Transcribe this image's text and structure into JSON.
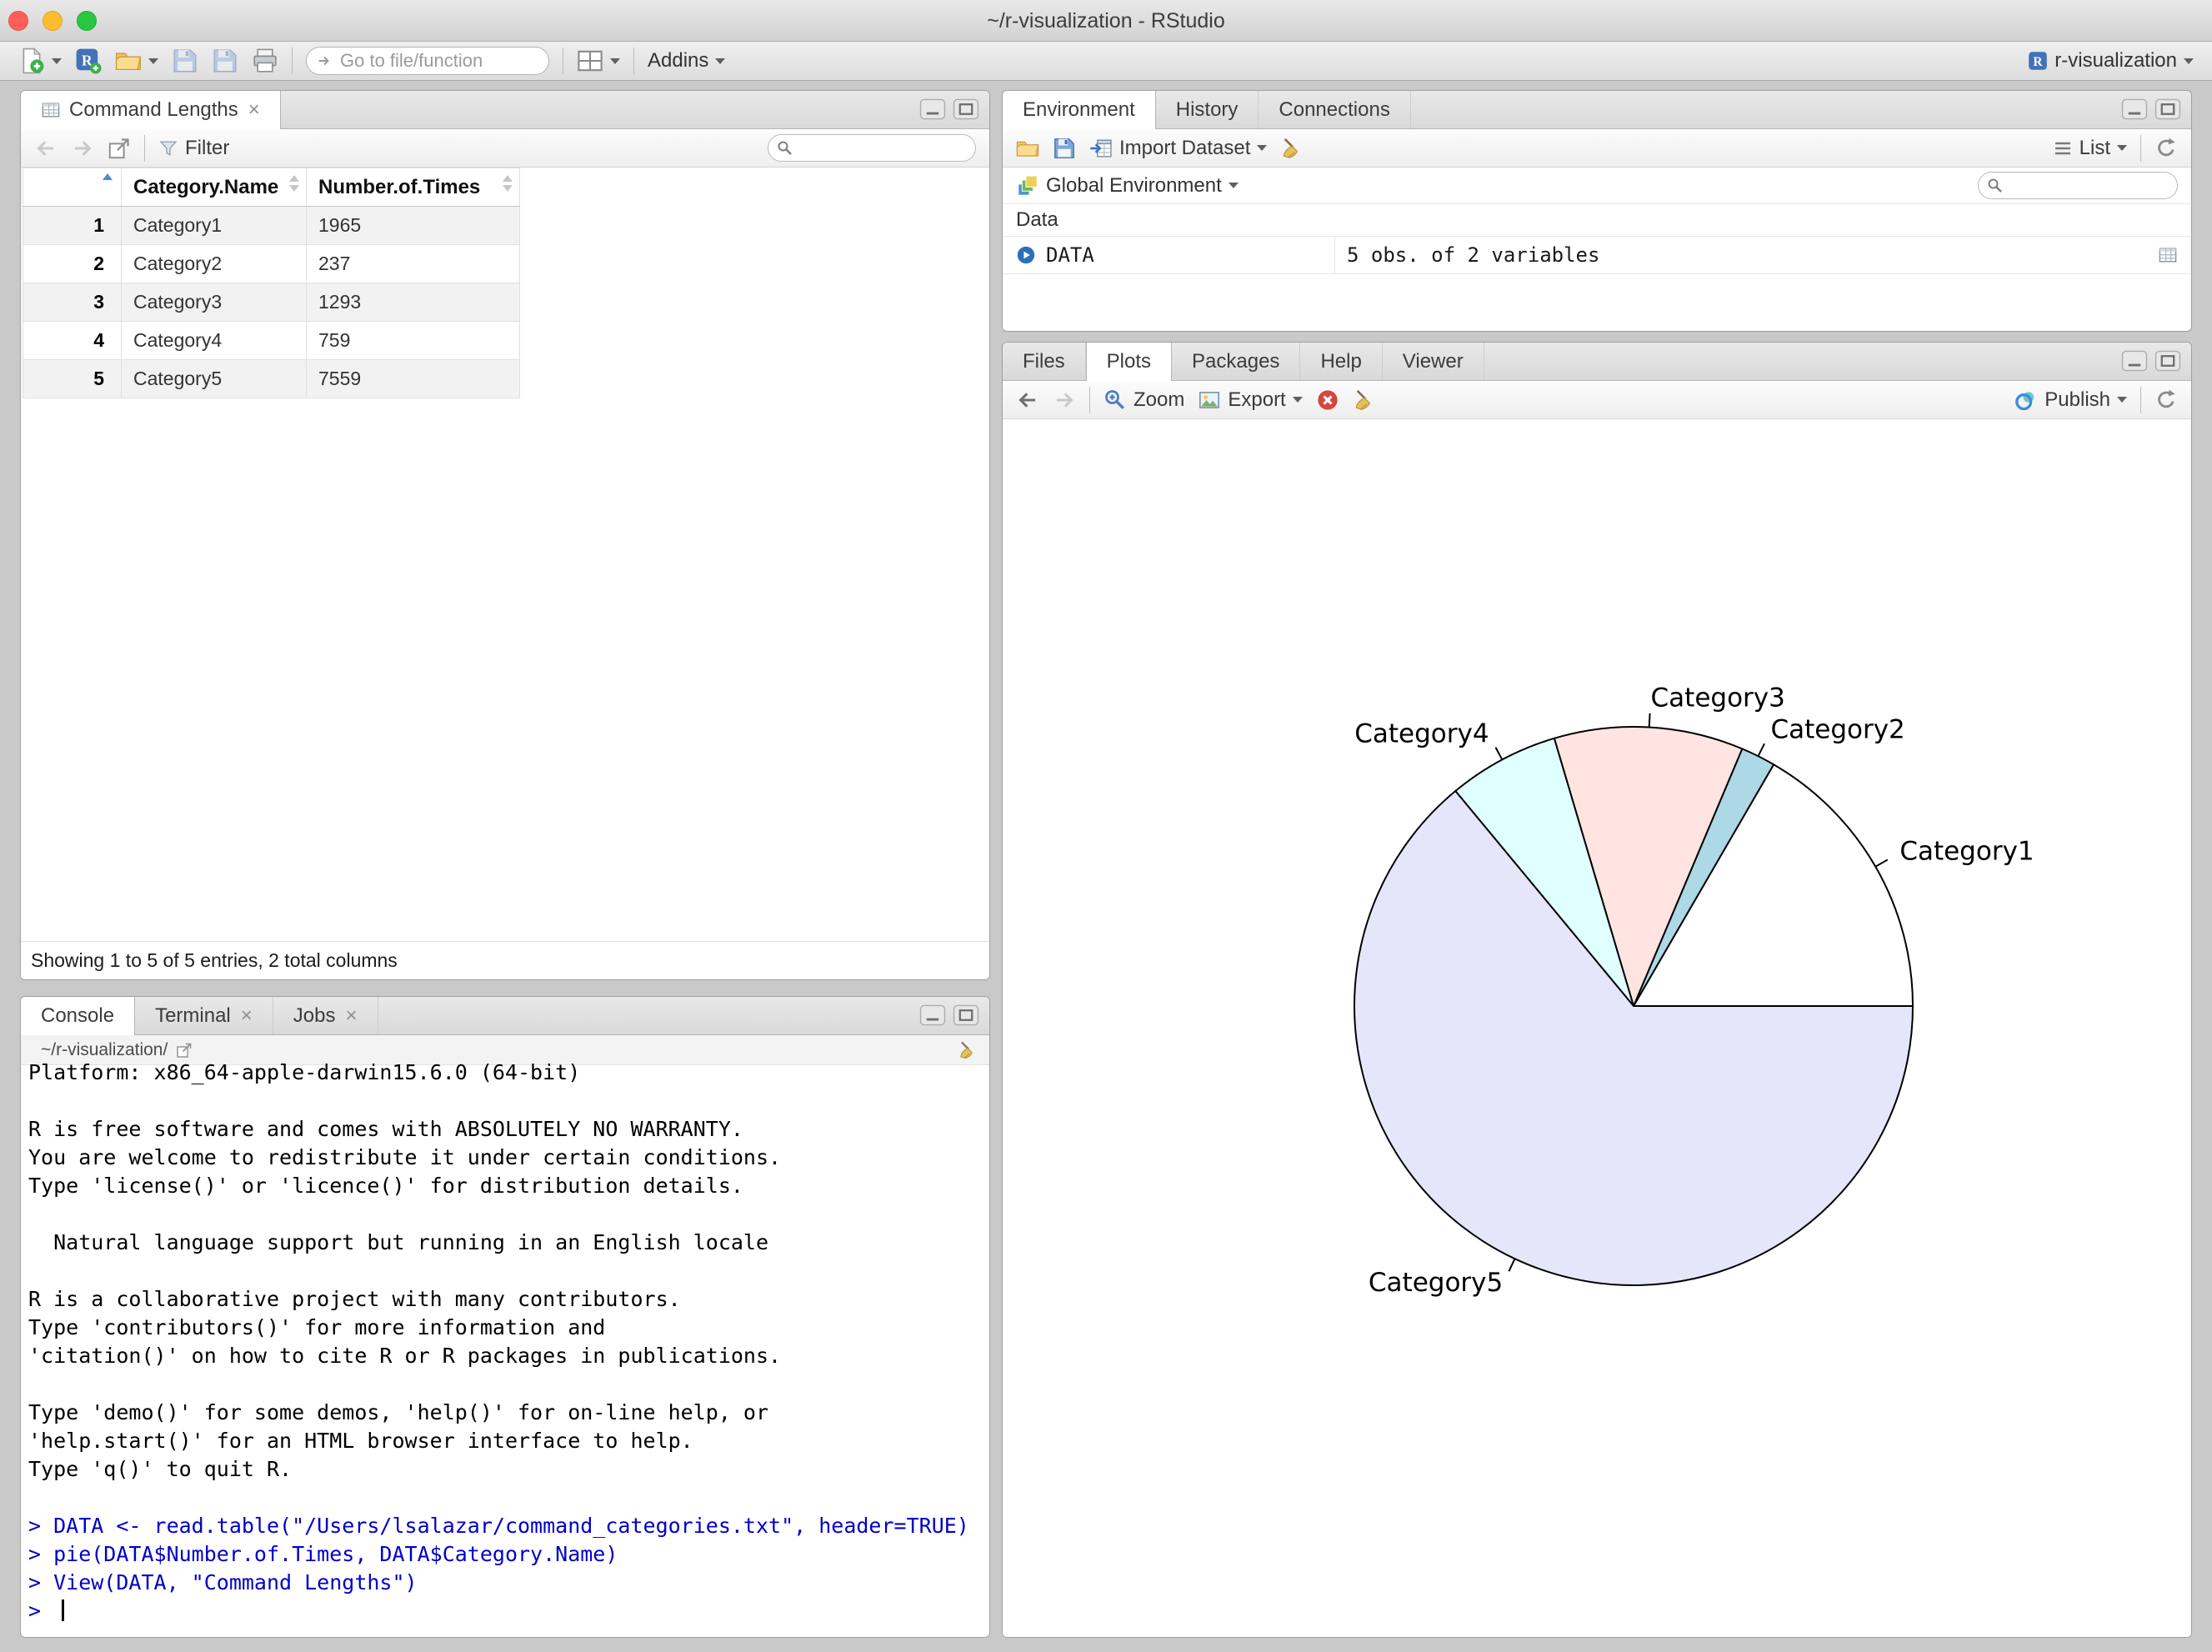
{
  "window": {
    "title": "~/r-visualization - RStudio"
  },
  "icons": {
    "close_glyph": "×",
    "r_logo": "R"
  },
  "colors": {
    "command_blue": "#0000C8",
    "traffic_lights": [
      "#FF5F57",
      "#FEBC2E",
      "#28C840"
    ]
  },
  "main_toolbar": {
    "goto_placeholder": "Go to file/function",
    "addins_label": "Addins",
    "project_name": "r-visualization"
  },
  "data_viewer": {
    "tab_title": "Command Lengths",
    "filter_label": "Filter",
    "columns": [
      "Category.Name",
      "Number.of.Times"
    ],
    "rows": [
      {
        "n": "1",
        "category": "Category1",
        "times": "1965"
      },
      {
        "n": "2",
        "category": "Category2",
        "times": "237"
      },
      {
        "n": "3",
        "category": "Category3",
        "times": "1293"
      },
      {
        "n": "4",
        "category": "Category4",
        "times": "759"
      },
      {
        "n": "5",
        "category": "Category5",
        "times": "7559"
      }
    ],
    "footer": "Showing 1 to 5 of 5 entries, 2 total columns"
  },
  "environment_pane": {
    "tabs": [
      "Environment",
      "History",
      "Connections"
    ],
    "toolbar": {
      "import_dataset_label": "Import Dataset",
      "list_label": "List"
    },
    "scope_label": "Global Environment",
    "section_label": "Data",
    "objects": [
      {
        "name": "DATA",
        "value": "5 obs. of 2 variables"
      }
    ]
  },
  "plots_pane": {
    "tabs": [
      "Files",
      "Plots",
      "Packages",
      "Help",
      "Viewer"
    ],
    "active_tab": "Plots",
    "toolbar": {
      "zoom_label": "Zoom",
      "export_label": "Export",
      "publish_label": "Publish"
    }
  },
  "console_pane": {
    "tabs": [
      "Console",
      "Terminal",
      "Jobs"
    ],
    "working_directory": "~/r-visualization/",
    "lines": [
      {
        "type": "out",
        "text": "Platform: x86_64-apple-darwin15.6.0 (64-bit)"
      },
      {
        "type": "out",
        "text": ""
      },
      {
        "type": "out",
        "text": "R is free software and comes with ABSOLUTELY NO WARRANTY."
      },
      {
        "type": "out",
        "text": "You are welcome to redistribute it under certain conditions."
      },
      {
        "type": "out",
        "text": "Type 'license()' or 'licence()' for distribution details."
      },
      {
        "type": "out",
        "text": ""
      },
      {
        "type": "out",
        "text": "  Natural language support but running in an English locale"
      },
      {
        "type": "out",
        "text": ""
      },
      {
        "type": "out",
        "text": "R is a collaborative project with many contributors."
      },
      {
        "type": "out",
        "text": "Type 'contributors()' for more information and"
      },
      {
        "type": "out",
        "text": "'citation()' on how to cite R or R packages in publications."
      },
      {
        "type": "out",
        "text": ""
      },
      {
        "type": "out",
        "text": "Type 'demo()' for some demos, 'help()' for on-line help, or"
      },
      {
        "type": "out",
        "text": "'help.start()' for an HTML browser interface to help."
      },
      {
        "type": "out",
        "text": "Type 'q()' to quit R."
      },
      {
        "type": "out",
        "text": ""
      },
      {
        "type": "in",
        "text": "> DATA <- read.table(\"/Users/lsalazar/command_categories.txt\", header=TRUE)"
      },
      {
        "type": "in",
        "text": "> pie(DATA$Number.of.Times, DATA$Category.Name)"
      },
      {
        "type": "in",
        "text": "> View(DATA, \"Command Lengths\")"
      },
      {
        "type": "in",
        "text": "> ",
        "cursor": true
      }
    ]
  },
  "chart_data": {
    "type": "pie",
    "title": "",
    "labels": [
      "Category1",
      "Category2",
      "Category3",
      "Category4",
      "Category5"
    ],
    "values": [
      1965,
      237,
      1293,
      759,
      7559
    ],
    "colors": [
      "#FFFFFF",
      "#ADD8E6",
      "#FFE4E1",
      "#E0FFFF",
      "#E6E6FA"
    ],
    "start_angle_deg": 0,
    "direction": "counterclockwise",
    "stroke_color": "#000000",
    "legend": "none"
  }
}
